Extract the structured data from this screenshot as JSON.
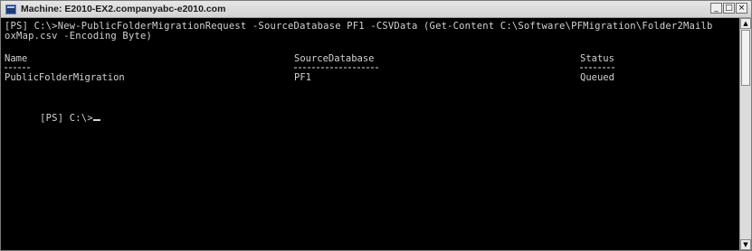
{
  "window": {
    "title": "Machine: E2010-EX2.companyabc-e2010.com",
    "controls": {
      "minimize": "_",
      "restore": "□",
      "close": "×"
    }
  },
  "console": {
    "command_line_1": "[PS] C:\\>New-PublicFolderMigrationRequest -SourceDatabase PF1 -CSVData (Get-Content C:\\Software\\PFMigration\\Folder2Mailb",
    "command_line_2": "oxMap.csv -Encoding Byte)",
    "table": {
      "headers": [
        "Name",
        "SourceDatabase",
        "Status"
      ],
      "rows": [
        [
          "PublicFolderMigration",
          "PF1",
          "Queued"
        ]
      ]
    },
    "prompt": "[PS] C:\\>"
  },
  "scrollbar": {
    "up_glyph": "▲",
    "down_glyph": "▼"
  },
  "icons": {
    "app": "powershell-console-icon"
  }
}
